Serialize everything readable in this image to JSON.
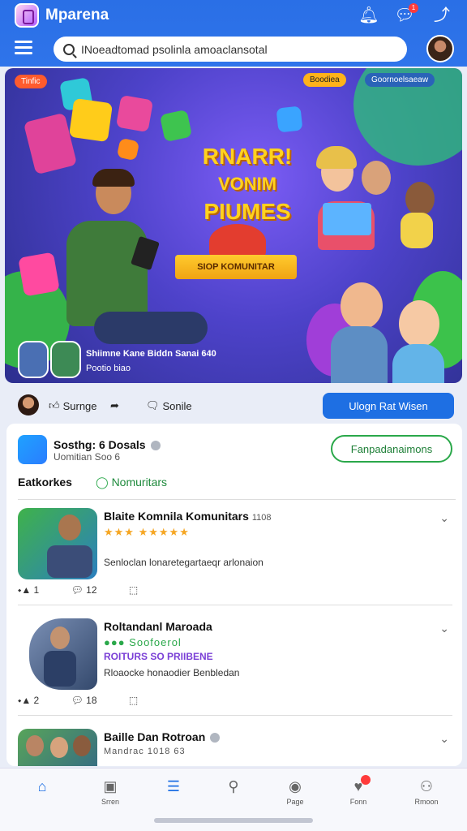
{
  "header": {
    "app_title": "Mparena",
    "notification_icon": "bell-icon",
    "chat_icon": "chat-icon",
    "chat_badge": "1",
    "share_icon": "share-icon"
  },
  "search": {
    "value": "INoeadtomad psolinla amoaclansotal"
  },
  "hero": {
    "badge_live": "Tinfic",
    "badge_a": "Boodiea",
    "badge_b": "Goornoelsaeaw",
    "title_lines": [
      "RNARR!",
      "VONIM",
      "PIUMES"
    ],
    "ribbon": "SIOP KOMUNITAR",
    "name": "Shiimne Kane Biddn Sanai 640",
    "subtitle": "Pootio biao"
  },
  "actions": {
    "like": "Surnge",
    "share": "",
    "comment": "Sonile",
    "join_button": "Ulogn Rat Wisen"
  },
  "community": {
    "title": "Sosthg: 6 Dosals",
    "subtitle": "Uomitian Soo 6",
    "follow_button": "Fanpadanaimons",
    "tab_active": "Eatkorkes",
    "tab_other": "Nomuritars"
  },
  "posts": [
    {
      "title": "Blaite Komnila Komunitars",
      "title_tag": "1108",
      "stars": "★★★ ★★★★★",
      "tag": "",
      "desc": "Senloclan lonaretegartaeqr arlonaion",
      "likes": "1",
      "comments": "12"
    },
    {
      "title": "Roltandanl Maroada",
      "title_tag": "",
      "stars": "●●● Soofoerol",
      "tag": "ROITURS SO PRIIBENE",
      "desc": "Rloaocke honaodier Benbledan",
      "likes": "2",
      "comments": "18"
    },
    {
      "title": "Baille Dan Rotroan",
      "title_tag": "",
      "stars": "Mandrac 1018 63",
      "tag": "",
      "desc": "",
      "likes": "",
      "comments": ""
    }
  ],
  "nav": {
    "home": "",
    "n2": "Srren",
    "n3": "",
    "n4": "",
    "n5": "Page",
    "n6": "Fonn",
    "n7": "Rmoon"
  },
  "colors": {
    "primary": "#2f74ea",
    "green": "#2aa84a"
  }
}
